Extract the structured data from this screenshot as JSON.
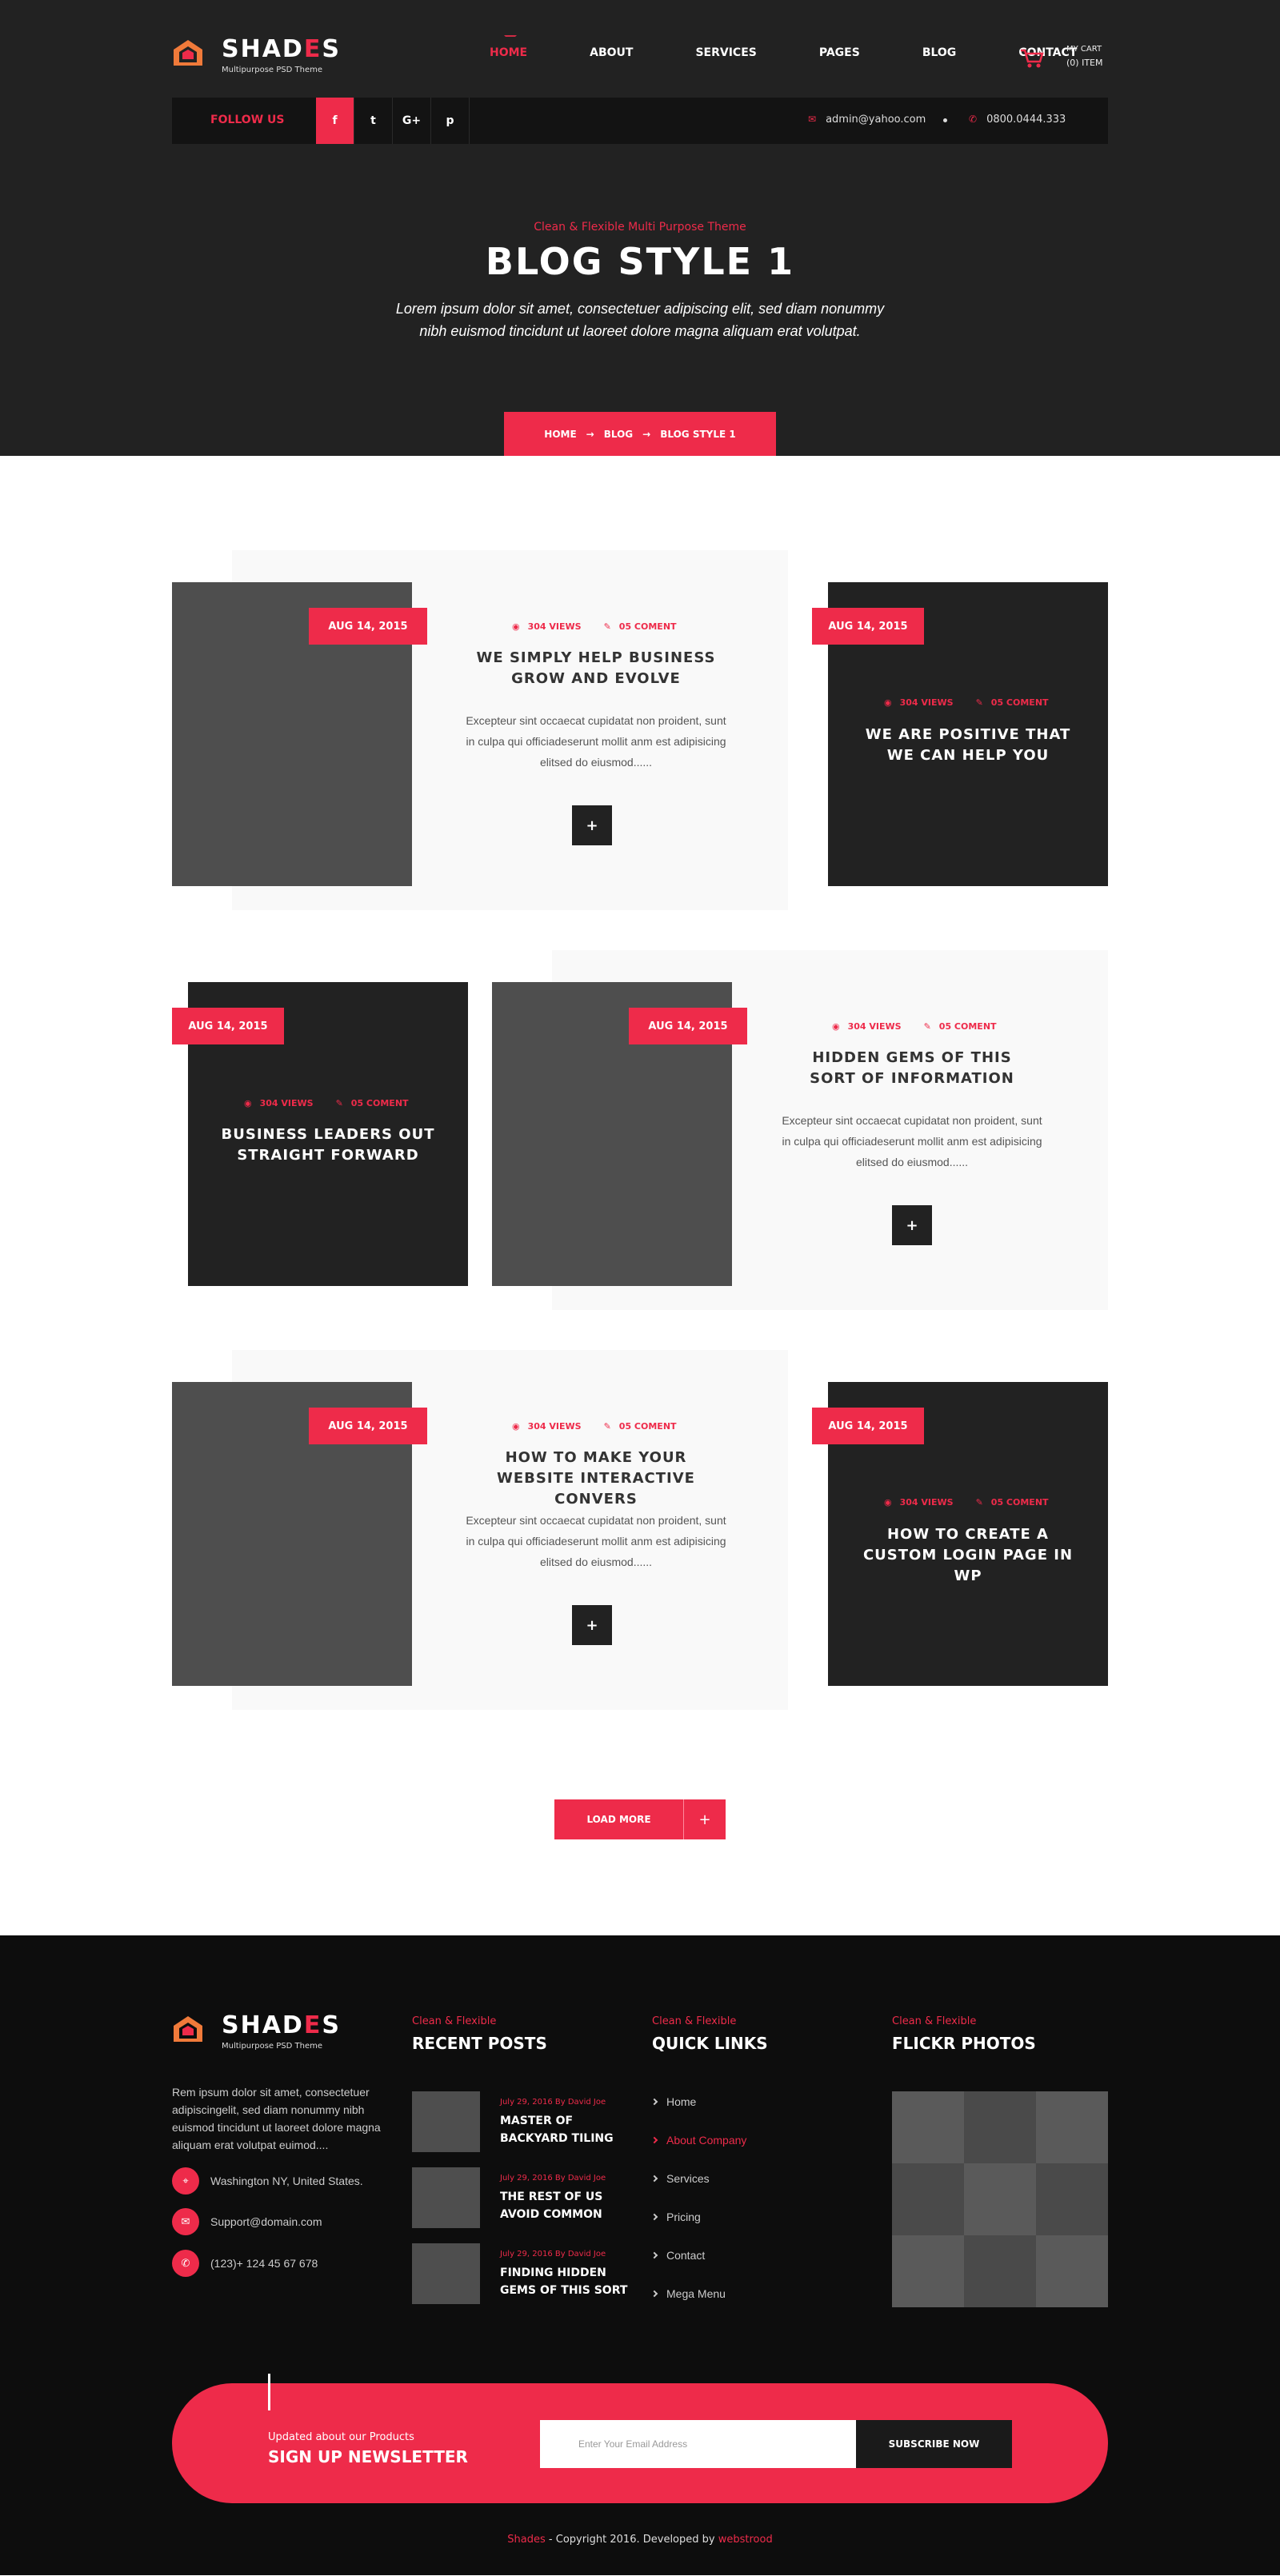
{
  "brand": {
    "name_prefix": "SHAD",
    "name_accent": "E",
    "name_suffix": "S",
    "tagline": "Multipurpose PSD Theme",
    "accent_color": "#ee2b4a",
    "dark_color": "#222222"
  },
  "nav": {
    "items": [
      "HOME",
      "ABOUT",
      "SERVICES",
      "PAGES",
      "BLOG",
      "CONTACT"
    ],
    "active": "HOME",
    "cart_label": "MY CART",
    "cart_count": "(0) ITEM"
  },
  "topbar": {
    "follow_label": "FOLLOW US",
    "social": [
      "f",
      "t",
      "G+",
      "p"
    ],
    "email": "admin@yahoo.com",
    "phone": "0800.0444.333"
  },
  "hero": {
    "kicker": "Clean & Flexible Multi Purpose Theme",
    "title": "BLOG STYLE 1",
    "description": "Lorem ipsum dolor sit amet, consectetuer adipiscing elit, sed diam nonummy nibh euismod tincidunt ut laoreet dolore magna aliquam erat volutpat.",
    "breadcrumb": [
      "HOME",
      "BLOG",
      "BLOG STYLE 1"
    ],
    "breadcrumb_sep": "→"
  },
  "posts": [
    {
      "date": "AUG 14, 2015",
      "views": "304 VIEWS",
      "comments": "05 COMENT",
      "title": "WE SIMPLY HELP BUSINESS GROW AND EVOLVE",
      "excerpt": "Excepteur sint occaecat cupidatat non proident, sunt in culpa  qui officiadeserunt mollit anm est adipisicing elitsed do eiusmod......",
      "button": "+"
    },
    {
      "date": "AUG 14, 2015",
      "views": "304 VIEWS",
      "comments": "05 COMENT",
      "title": "WE ARE POSITIVE THAT WE CAN HELP YOU"
    },
    {
      "date": "AUG 14, 2015",
      "views": "304 VIEWS",
      "comments": "05 COMENT",
      "title": "BUSINESS LEADERS OUT STRAIGHT FORWARD"
    },
    {
      "date": "AUG 14, 2015",
      "views": "304 VIEWS",
      "comments": "05 COMENT",
      "title": "HIDDEN GEMS OF THIS SORT OF INFORMATION",
      "excerpt": "Excepteur sint occaecat cupidatat non proident, sunt in culpa  qui officiadeserunt mollit anm est adipisicing elitsed do eiusmod......",
      "button": "+"
    },
    {
      "date": "AUG 14, 2015",
      "views": "304 VIEWS",
      "comments": "05 COMENT",
      "title": "HOW TO MAKE YOUR WEBSITE INTERACTIVE CONVERS",
      "excerpt": "Excepteur sint occaecat cupidatat non proident, sunt in culpa  qui officiadeserunt mollit anm est adipisicing elitsed do eiusmod......",
      "button": "+"
    },
    {
      "date": "AUG 14, 2015",
      "views": "304 VIEWS",
      "comments": "05 COMENT",
      "title": "HOW TO CREATE A CUSTOM LOGIN PAGE IN WP"
    }
  ],
  "load_more": {
    "label": "LOAD MORE",
    "plus": "+"
  },
  "footer": {
    "about": "Rem ipsum dolor sit amet, consectetuer adipiscingelit, sed diam nonummy nibh euismod tincidunt ut laoreet dolore magna aliquam erat volutpat euimod....",
    "contacts": [
      "Washington NY, United States.",
      "Support@domain.com",
      "(123)+ 124 45 67 678"
    ],
    "recent": {
      "kicker": "Clean & Flexible",
      "heading": "RECENT POSTS",
      "items": [
        {
          "meta": "July 29, 2016   By David Joe",
          "title": "MASTER OF BACKYARD TILING"
        },
        {
          "meta": "July 29, 2016   By David Joe",
          "title": "THE REST OF US AVOID COMMON"
        },
        {
          "meta": "July 29, 2016   By David Joe",
          "title": "FINDING HIDDEN GEMS OF THIS SORT"
        }
      ]
    },
    "quick": {
      "kicker": "Clean & Flexible",
      "heading": "QUICK LINKS",
      "links": [
        "Home",
        "About Company",
        "Services",
        "Pricing",
        "Contact",
        "Mega Menu"
      ],
      "active": "About Company"
    },
    "flickr": {
      "kicker": "Clean & Flexible",
      "heading": "FLICKR PHOTOS"
    },
    "newsletter": {
      "subtitle": "Updated about our Products",
      "title": "SIGN UP NEWSLETTER",
      "placeholder": "Enter Your Email Address",
      "button": "SUBSCRIBE NOW"
    },
    "copyright": {
      "brand": "Shades",
      "text": " - Copyright 2016. Developed by ",
      "dev": "webstrood"
    }
  }
}
